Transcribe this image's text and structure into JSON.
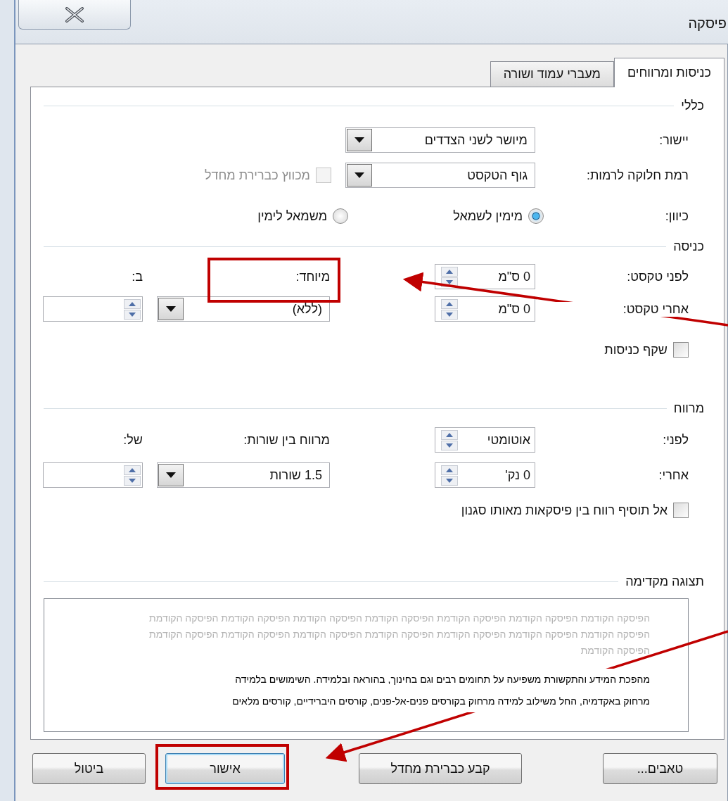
{
  "window": {
    "title": "פיסקה"
  },
  "tabs": [
    {
      "label": "כניסות ומרווחים",
      "selected": true
    },
    {
      "label": "מעברי עמוד ושורה",
      "selected": false
    }
  ],
  "general": {
    "heading": "כללי",
    "alignment": {
      "label": "יישור:",
      "value": "מיושר לשני הצדדים"
    },
    "outline_level": {
      "label": "רמת חלוקה לרמות:",
      "value": "גוף הטקסט"
    },
    "collapsed": {
      "label": "מכווץ כברירת מחדל",
      "checked": false,
      "disabled": true
    },
    "direction": {
      "label": "כיוון:",
      "options": [
        {
          "label": "מימין לשמאל",
          "selected": true
        },
        {
          "label": "משמאל לימין",
          "selected": false
        }
      ]
    }
  },
  "indentation": {
    "heading": "כניסה",
    "before_text": {
      "label": "לפני טקסט:",
      "value": "0 ס\"מ"
    },
    "after_text": {
      "label": "אחרי טקסט:",
      "value": "0 ס\"מ"
    },
    "special": {
      "label": "מיוחד:",
      "value": "(ללא)"
    },
    "by": {
      "label": "ב:"
    },
    "mirror": {
      "label": "שקף כניסות",
      "checked": false,
      "disabled": false
    }
  },
  "spacing": {
    "heading": "מרווח",
    "before": {
      "label": "לפני:",
      "value": "אוטומטי"
    },
    "after": {
      "label": "אחרי:",
      "value": "0 נק'"
    },
    "line_spacing": {
      "label": "מרווח בין שורות:",
      "value": "1.5 שורות"
    },
    "at": {
      "label": "של:"
    },
    "dont_add": {
      "label": "אל תוסיף רווח בין פיסקאות מאותו סגנון",
      "checked": false,
      "disabled": false
    }
  },
  "preview": {
    "heading": "תצוגה מקדימה",
    "previous_lines": [
      "הפיסקה הקודמת הפיסקה הקודמת הפיסקה הקודמת הפיסקה הקודמת הפיסקה הקודמת הפיסקה הקודמת הפיסקה הקודמת",
      "הפיסקה הקודמת הפיסקה הקודמת הפיסקה הקודמת הפיסקה הקודמת הפיסקה הקודמת הפיסקה הקודמת הפיסקה הקודמת",
      "הפיסקה הקודמת"
    ],
    "sample_lines": [
      "מהפכת המידע והתקשורת משפיעה על תחומים רבים וגם בחינוך, בהוראה ובלמידה. השימושים בלמידה",
      "מרחוק באקדמיה, החל משילוב למידה מרחוק בקורסים פנים-אל-פנים, קורסים היברידיים, קורסים מלאים"
    ]
  },
  "buttons": [
    {
      "label": "טאבים...",
      "default": false
    },
    {
      "label": "קבע כברירת מחדל",
      "default": false
    },
    {
      "label": "אישור",
      "default": true
    },
    {
      "label": "ביטול",
      "default": false
    }
  ]
}
